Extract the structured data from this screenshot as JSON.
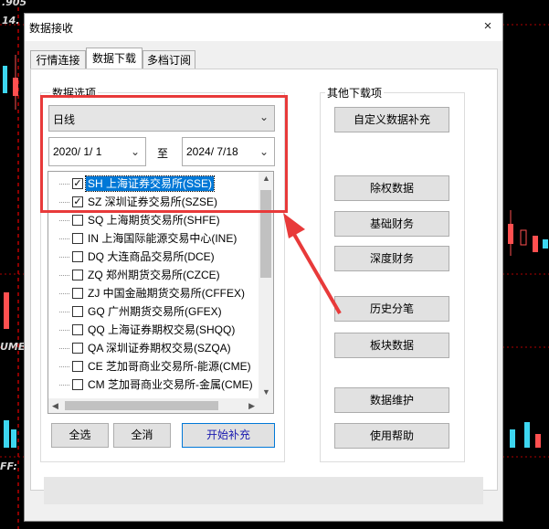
{
  "window": {
    "title": "数据接收",
    "close_icon": "×"
  },
  "tabs": [
    {
      "label": "行情连接",
      "active": false
    },
    {
      "label": "数据下载",
      "active": true
    },
    {
      "label": "多档订阅",
      "active": false
    }
  ],
  "data_options": {
    "group_label": "数据选项",
    "period": "日线",
    "start_date": "2020/ 1/ 1",
    "to_label": "至",
    "end_date": "2024/ 7/18",
    "markets": [
      {
        "label": "SH 上海证券交易所(SSE)",
        "checked": true,
        "selected": true
      },
      {
        "label": "SZ 深圳证券交易所(SZSE)",
        "checked": true,
        "selected": false
      },
      {
        "label": "SQ 上海期货交易所(SHFE)",
        "checked": false,
        "selected": false
      },
      {
        "label": "IN 上海国际能源交易中心(INE)",
        "checked": false,
        "selected": false
      },
      {
        "label": "DQ 大连商品交易所(DCE)",
        "checked": false,
        "selected": false
      },
      {
        "label": "ZQ 郑州期货交易所(CZCE)",
        "checked": false,
        "selected": false
      },
      {
        "label": "ZJ 中国金融期货交易所(CFFEX)",
        "checked": false,
        "selected": false
      },
      {
        "label": "GQ 广州期货交易所(GFEX)",
        "checked": false,
        "selected": false
      },
      {
        "label": "QQ 上海证券期权交易(SHQQ)",
        "checked": false,
        "selected": false
      },
      {
        "label": "QA 深圳证券期权交易(SZQA)",
        "checked": false,
        "selected": false
      },
      {
        "label": "CE 芝加哥商业交易所-能源(CME)",
        "checked": false,
        "selected": false
      },
      {
        "label": "CM 芝加哥商业交易所-金属(CME)",
        "checked": false,
        "selected": false
      }
    ],
    "select_all": "全选",
    "deselect_all": "全消",
    "start_download": "开始补充"
  },
  "other_downloads": {
    "group_label": "其他下载项",
    "buttons": [
      "自定义数据补充",
      "除权数据",
      "基础财务",
      "深度财务",
      "历史分笔",
      "板块数据",
      "数据维护",
      "使用帮助"
    ]
  },
  "background": {
    "top_text": "14.",
    "top_text2": ".905",
    "mid_text": "UME",
    "low_text": "FF:"
  },
  "colors": {
    "highlight": "#e83a3a",
    "selection": "#0078d7"
  }
}
